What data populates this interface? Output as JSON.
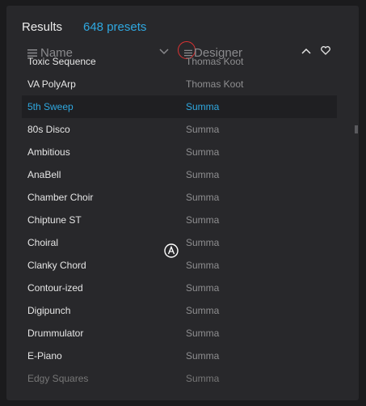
{
  "header": {
    "title": "Results",
    "count": "648 presets"
  },
  "columns": {
    "name_label": "Name",
    "designer_label": "Designer"
  },
  "icons": {
    "name_menu": "menu-icon",
    "designer_menu": "menu-icon",
    "name_sort": "chevron-down-icon",
    "sort_up": "chevron-up-icon",
    "favorites": "heart-icon",
    "cursor": "cursor-icon"
  },
  "colors": {
    "accent": "#2fa8e0",
    "highlight_circle": "#dd3333"
  },
  "rows": [
    {
      "name": "Toxic Sequence",
      "designer": "Thomas Koot"
    },
    {
      "name": "VA PolyArp",
      "designer": "Thomas Koot"
    },
    {
      "name": "5th Sweep",
      "designer": "Summa",
      "selected": true
    },
    {
      "name": "80s Disco",
      "designer": "Summa"
    },
    {
      "name": "Ambitious",
      "designer": "Summa"
    },
    {
      "name": "AnaBell",
      "designer": "Summa"
    },
    {
      "name": "Chamber Choir",
      "designer": "Summa"
    },
    {
      "name": "Chiptune ST",
      "designer": "Summa"
    },
    {
      "name": "Choiral",
      "designer": "Summa"
    },
    {
      "name": "Clanky Chord",
      "designer": "Summa"
    },
    {
      "name": "Contour-ized",
      "designer": "Summa"
    },
    {
      "name": "Digipunch",
      "designer": "Summa"
    },
    {
      "name": "Drummulator",
      "designer": "Summa"
    },
    {
      "name": "E-Piano",
      "designer": "Summa"
    },
    {
      "name": "Edgy Squares",
      "designer": "Summa"
    }
  ]
}
